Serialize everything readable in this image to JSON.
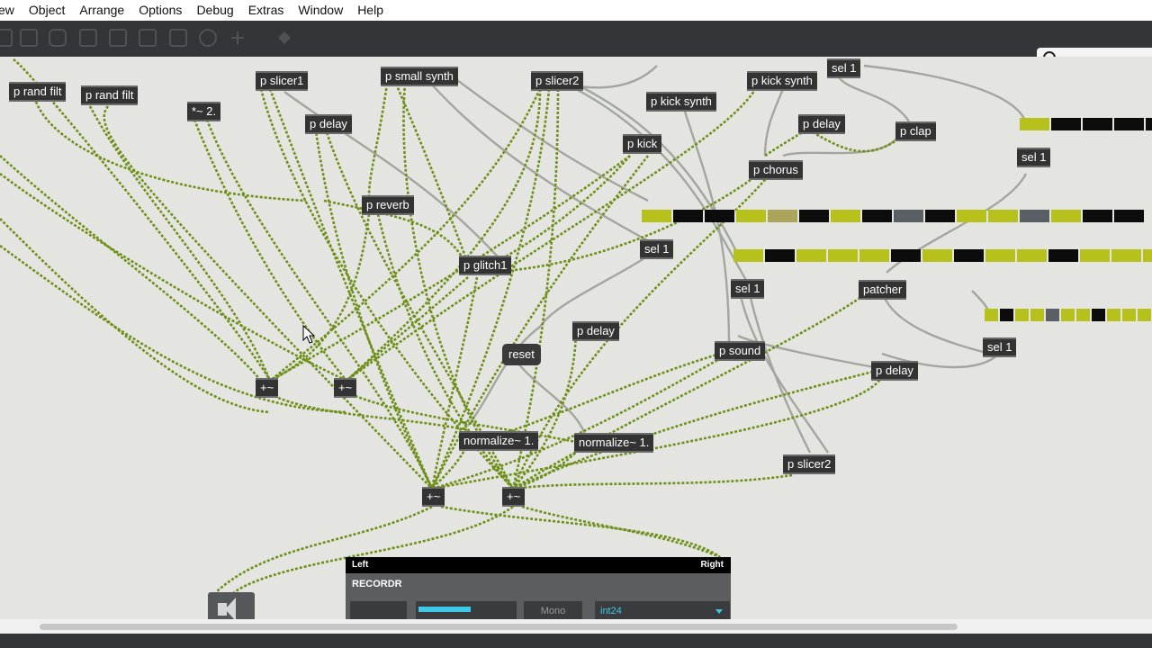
{
  "menu": {
    "items": [
      "ew",
      "Object",
      "Arrange",
      "Options",
      "Debug",
      "Extras",
      "Window",
      "Help"
    ]
  },
  "toolbar": {
    "icons": [
      "lock-icon",
      "presentation-icon",
      "comment-icon",
      "delete-icon",
      "snapshot-icon",
      "play-icon",
      "grid-icon",
      "dial-icon",
      "add-icon",
      "paint-icon"
    ]
  },
  "search": {
    "icon": "search-icon",
    "placeholder": ""
  },
  "patch": {
    "objects": {
      "p_rand_filt_1": "p rand filt",
      "p_rand_filt_2": "p rand filt",
      "mul_2": "*~ 2.",
      "p_slicer1": "p slicer1",
      "p_small_synth": "p small synth",
      "p_slicer2_top": "p slicer2",
      "p_kick_synth_1": "p kick synth",
      "p_kick_synth_2": "p kick synth",
      "sel_1_top": "sel 1",
      "p_delay_1": "p delay",
      "p_delay_2": "p delay",
      "p_clap": "p clap",
      "p_kick": "p kick",
      "p_chorus": "p chorus",
      "sel_1_right": "sel 1",
      "p_reverb": "p reverb",
      "sel_1_mid": "sel 1",
      "p_glitch1": "p glitch1",
      "sel_1_b": "sel 1",
      "patcher": "patcher",
      "sel_1_far": "sel 1",
      "p_delay_3": "p delay",
      "p_sound": "p sound",
      "p_delay_4": "p delay",
      "plus_a": "+~",
      "plus_b": "+~",
      "normalize_1": "normalize~ 1.",
      "normalize_2": "normalize~ 1.",
      "p_slicer2_bottom": "p slicer2",
      "plus_c": "+~",
      "plus_d": "+~"
    },
    "message": {
      "reset": "reset"
    },
    "step_colors": {
      "active": "#b7c11b",
      "active_dim": "#aaa55a",
      "off": "#0c0c0c",
      "mid": "#5a5f66"
    },
    "sequencers": {
      "row1": [
        "active",
        "off",
        "off",
        "off",
        "off"
      ],
      "row2": [
        "active",
        "off",
        "off",
        "active",
        "active_dim",
        "off",
        "active",
        "off",
        "mid",
        "off",
        "active",
        "active",
        "mid",
        "active",
        "off",
        "off"
      ],
      "row3": [
        "active",
        "off",
        "active",
        "active",
        "active",
        "off",
        "active",
        "off",
        "active",
        "active",
        "off",
        "active",
        "active",
        "active"
      ],
      "row4": [
        "active",
        "off",
        "active",
        "active",
        "mid",
        "active",
        "active",
        "off",
        "active",
        "active",
        "active"
      ]
    },
    "cord_color": "#6e8f1a"
  },
  "recordr": {
    "left_label": "Left",
    "right_label": "Right",
    "title": "RECORDR",
    "mono_label": "Mono",
    "format_value": "int24"
  },
  "speaker": {
    "icon": "speaker-icon"
  }
}
